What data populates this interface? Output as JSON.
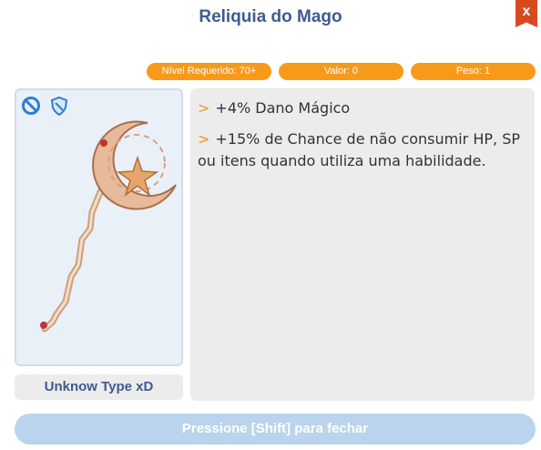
{
  "window": {
    "title": "Reliquia do Mago",
    "close_label": "x"
  },
  "stats": {
    "level": "Nível Requerido: 70+",
    "value": "Valor: 0",
    "weight": "Peso: 1"
  },
  "item": {
    "icons": [
      "no-sell-icon",
      "shield-icon"
    ],
    "type_label": "Unknow Type xD"
  },
  "description": {
    "marker": ">",
    "lines": [
      "+4% Dano Mágico",
      "+15% de Chance de não consumir HP, SP ou itens quando utiliza uma habilidade."
    ]
  },
  "footer": {
    "close_hint": "Pressione [Shift] para fechar"
  },
  "colors": {
    "title": "#3e5b8f",
    "accent": "#f79a1a",
    "close": "#d9491f",
    "footer_button": "#b9d4ec"
  }
}
